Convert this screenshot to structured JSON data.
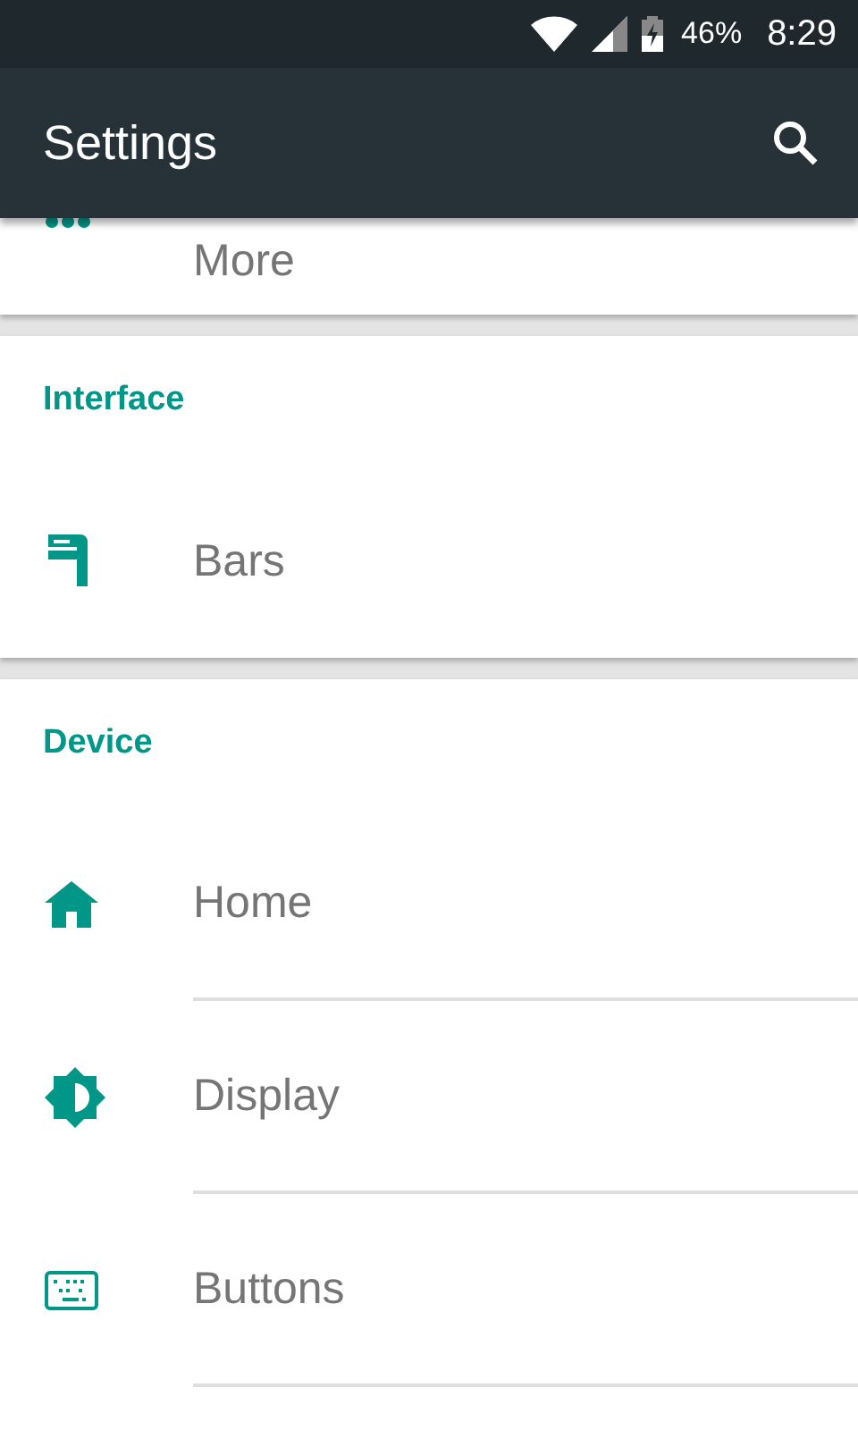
{
  "status_bar": {
    "battery": "46%",
    "time": "8:29"
  },
  "app_bar": {
    "title": "Settings"
  },
  "sections": [
    {
      "items": [
        {
          "label": "More"
        }
      ]
    },
    {
      "header": "Interface",
      "items": [
        {
          "label": "Bars"
        }
      ]
    },
    {
      "header": "Device",
      "items": [
        {
          "label": "Home"
        },
        {
          "label": "Display"
        },
        {
          "label": "Buttons"
        }
      ]
    }
  ]
}
